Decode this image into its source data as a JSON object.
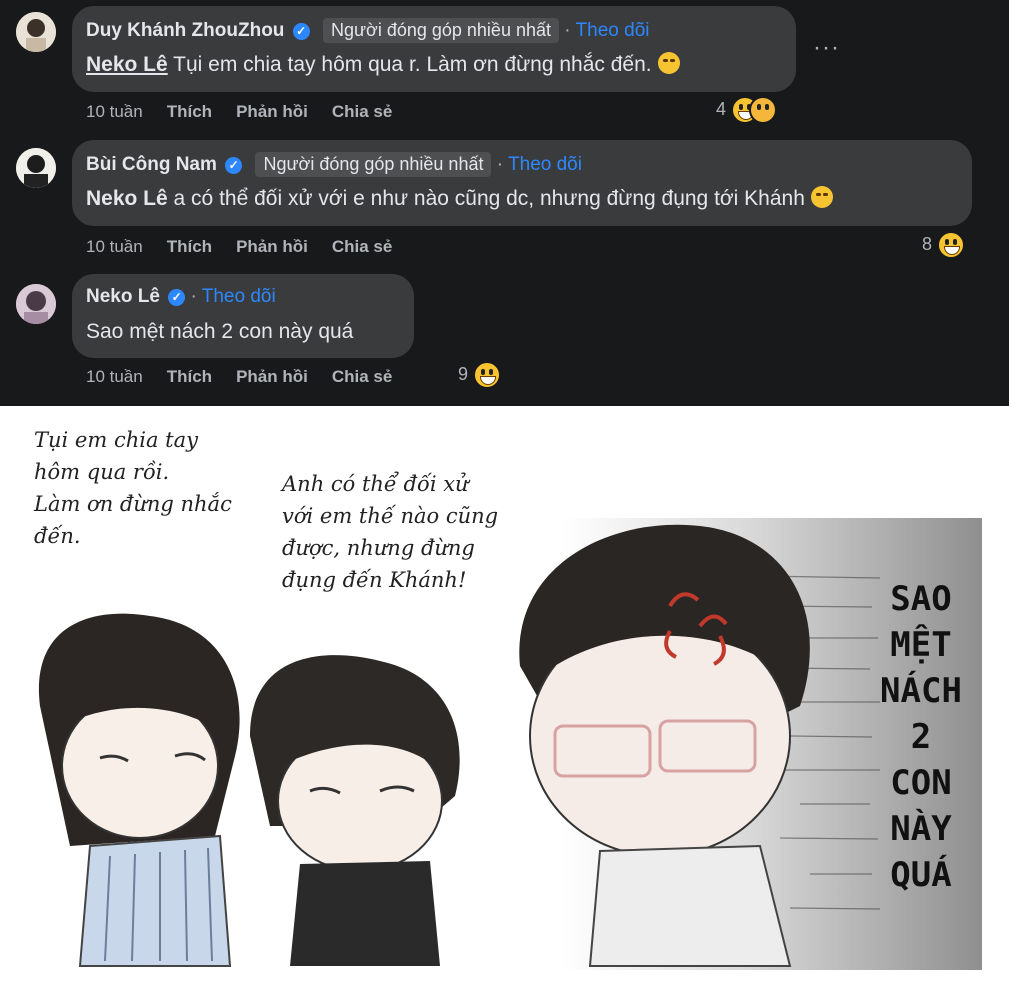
{
  "comments": [
    {
      "author": "Duy Khánh ZhouZhou",
      "verified_mark": "✓",
      "badge": "Người đóng góp nhiều nhất",
      "separator": "·",
      "follow": "Theo dõi",
      "mention": "Neko Lê",
      "text": "Tụi em chia tay hôm qua r. Làm ơn đừng nhắc đến.",
      "time": "10 tuần",
      "like": "Thích",
      "reply": "Phản hồi",
      "share": "Chia sẻ",
      "reactions": "4"
    },
    {
      "author": "Bùi Công Nam",
      "verified_mark": "✓",
      "badge": "Người đóng góp nhiều nhất",
      "separator": "·",
      "follow": "Theo dõi",
      "mention": "Neko Lê",
      "text": "a có thể đối xử với e như nào cũng dc, nhưng đừng đụng tới Khánh",
      "time": "10 tuần",
      "like": "Thích",
      "reply": "Phản hồi",
      "share": "Chia sẻ",
      "reactions": "8"
    },
    {
      "author": "Neko Lê",
      "verified_mark": "✓",
      "separator": "·",
      "follow": "Theo dõi",
      "text": "Sao mệt nách 2 con này quá",
      "time": "10 tuần",
      "like": "Thích",
      "reply": "Phản hồi",
      "share": "Chia sẻ",
      "reactions": "9"
    }
  ],
  "more_menu": "···",
  "panel": {
    "bubble1": "Tụi em chia tay\nhôm qua rồi.\nLàm ơn đừng nhắc\nđến.",
    "bubble2": "Anh có thể đối xử\nvới em thế nào cũng\nđược, nhưng đừng\nđụng đến Khánh!",
    "shout": "SAO\nMỆT\nNÁCH\n2\nCON\nNÀY\nQUÁ"
  }
}
